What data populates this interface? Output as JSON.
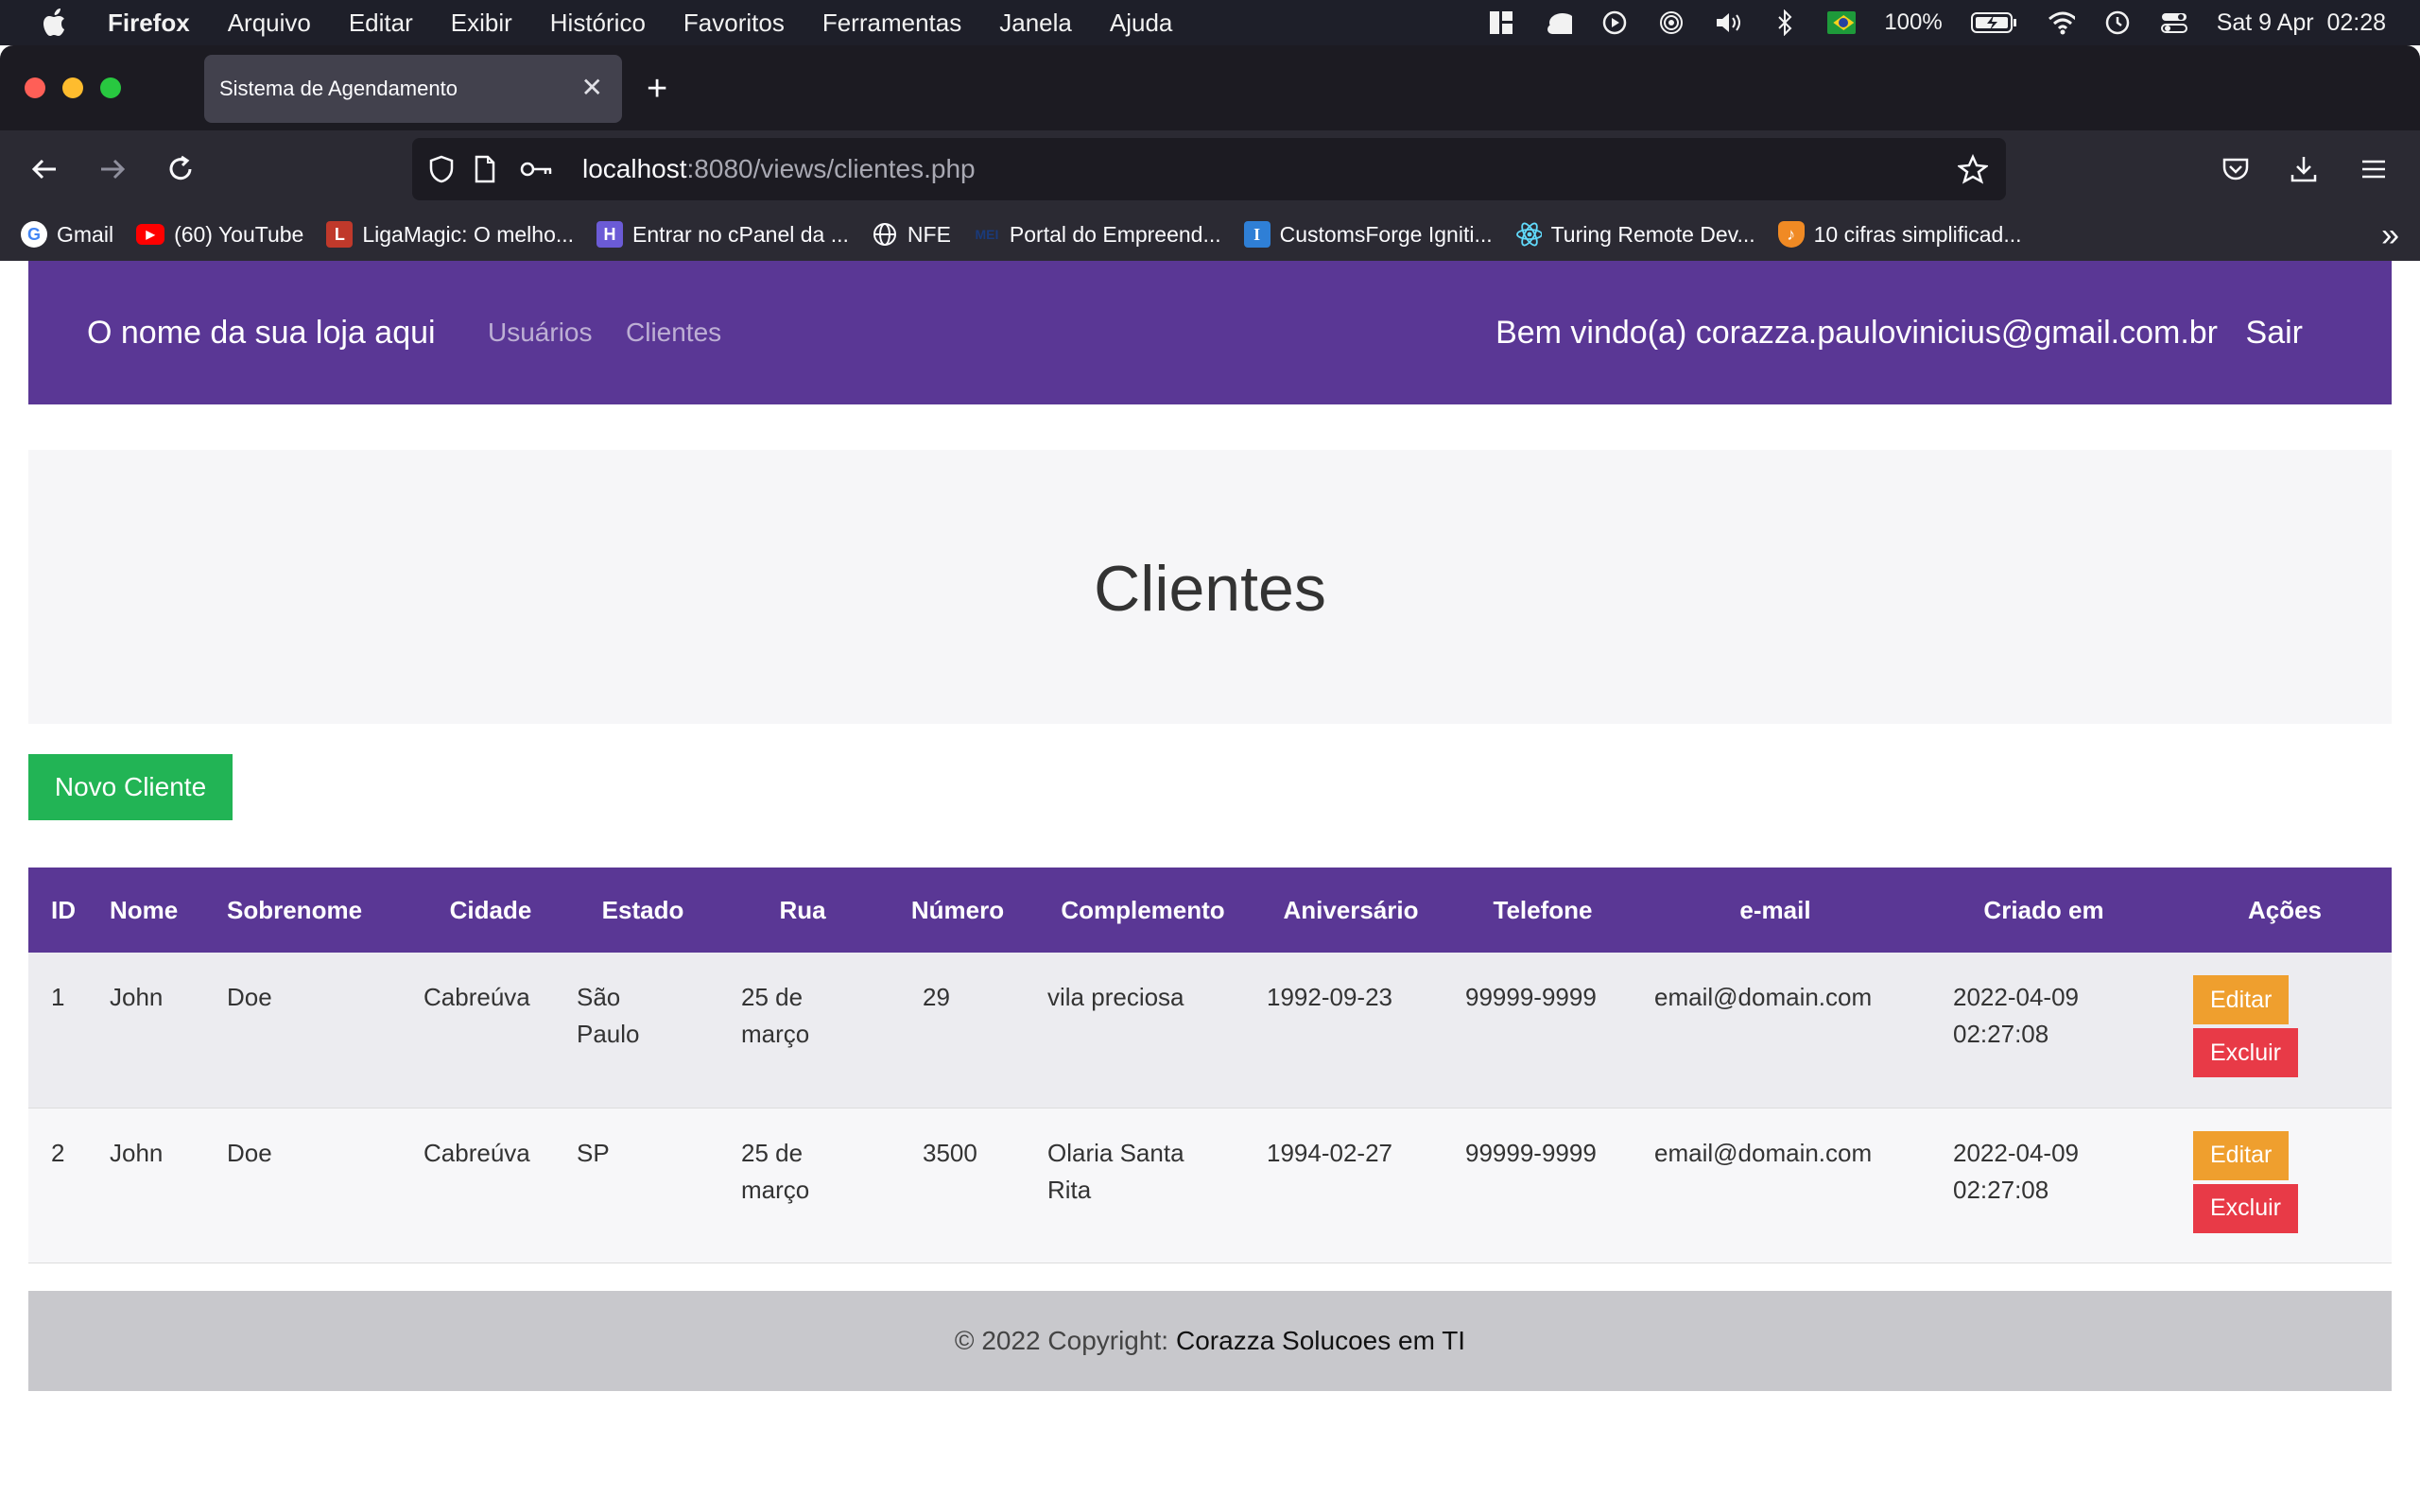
{
  "menubar": {
    "app_name": "Firefox",
    "menus": [
      "Arquivo",
      "Editar",
      "Exibir",
      "Histórico",
      "Favoritos",
      "Ferramentas",
      "Janela",
      "Ajuda"
    ],
    "battery": "100%",
    "datetime": "Sat 9 Apr  02:28"
  },
  "browser": {
    "tab_title": "Sistema de Agendamento",
    "url_host": "localhost",
    "url_rest": ":8080/views/clientes.php",
    "bookmarks": [
      {
        "label": "Gmail",
        "icon": "google-icon",
        "color": "#ffffff"
      },
      {
        "label": "(60) YouTube",
        "icon": "youtube-icon",
        "color": "#ff0000"
      },
      {
        "label": "LigaMagic: O melho...",
        "icon": "ligamagic-icon",
        "color": "#c0392b"
      },
      {
        "label": "Entrar no cPanel da ...",
        "icon": "cpanel-icon",
        "color": "#6b5bd6"
      },
      {
        "label": "NFE",
        "icon": "globe-icon",
        "color": "#2b2a33"
      },
      {
        "label": "Portal do Empreend...",
        "icon": "mei-icon",
        "color": "#1a3a7a"
      },
      {
        "label": "CustomsForge Igniti...",
        "icon": "customsforge-icon",
        "color": "#2f7fd6"
      },
      {
        "label": "Turing Remote Dev...",
        "icon": "react-icon",
        "color": "#2b2a33"
      },
      {
        "label": "10 cifras simplificad...",
        "icon": "cifras-icon",
        "color": "#f08a24"
      }
    ]
  },
  "site": {
    "brand": "O nome da sua loja aqui",
    "nav": [
      "Usuários",
      "Clientes"
    ],
    "welcome": "Bem vindo(a) corazza.paulovinicius@gmail.com.br",
    "logout": "Sair",
    "title": "Clientes",
    "new_button": "Novo Cliente"
  },
  "table": {
    "headers": [
      "ID",
      "Nome",
      "Sobrenome",
      "Cidade",
      "Estado",
      "Rua",
      "Número",
      "Complemento",
      "Aniversário",
      "Telefone",
      "e-mail",
      "Criado em",
      "Ações"
    ],
    "rows": [
      {
        "id": "1",
        "nome": "John",
        "sobrenome": "Doe",
        "cidade": "Cabreúva",
        "estado": "São Paulo",
        "rua": "25 de março",
        "numero": "29",
        "complemento": "vila preciosa",
        "aniversario": "1992-09-23",
        "telefone": "99999-9999",
        "email": "email@domain.com",
        "criado": "2022-04-09 02:27:08",
        "edit": "Editar",
        "delete": "Excluir"
      },
      {
        "id": "2",
        "nome": "John",
        "sobrenome": "Doe",
        "cidade": "Cabreúva",
        "estado": "SP",
        "rua": "25 de março",
        "numero": "3500",
        "complemento": "Olaria Santa Rita",
        "aniversario": "1994-02-27",
        "telefone": "99999-9999",
        "email": "email@domain.com",
        "criado": "2022-04-09 02:27:08",
        "edit": "Editar",
        "delete": "Excluir"
      }
    ]
  },
  "footer": {
    "copyright": "© 2022 Copyright:",
    "company": "Corazza Solucoes em TI"
  },
  "colors": {
    "primary": "#5a3795",
    "success": "#22b455",
    "warning": "#ef9f2e",
    "danger": "#e83a47"
  }
}
